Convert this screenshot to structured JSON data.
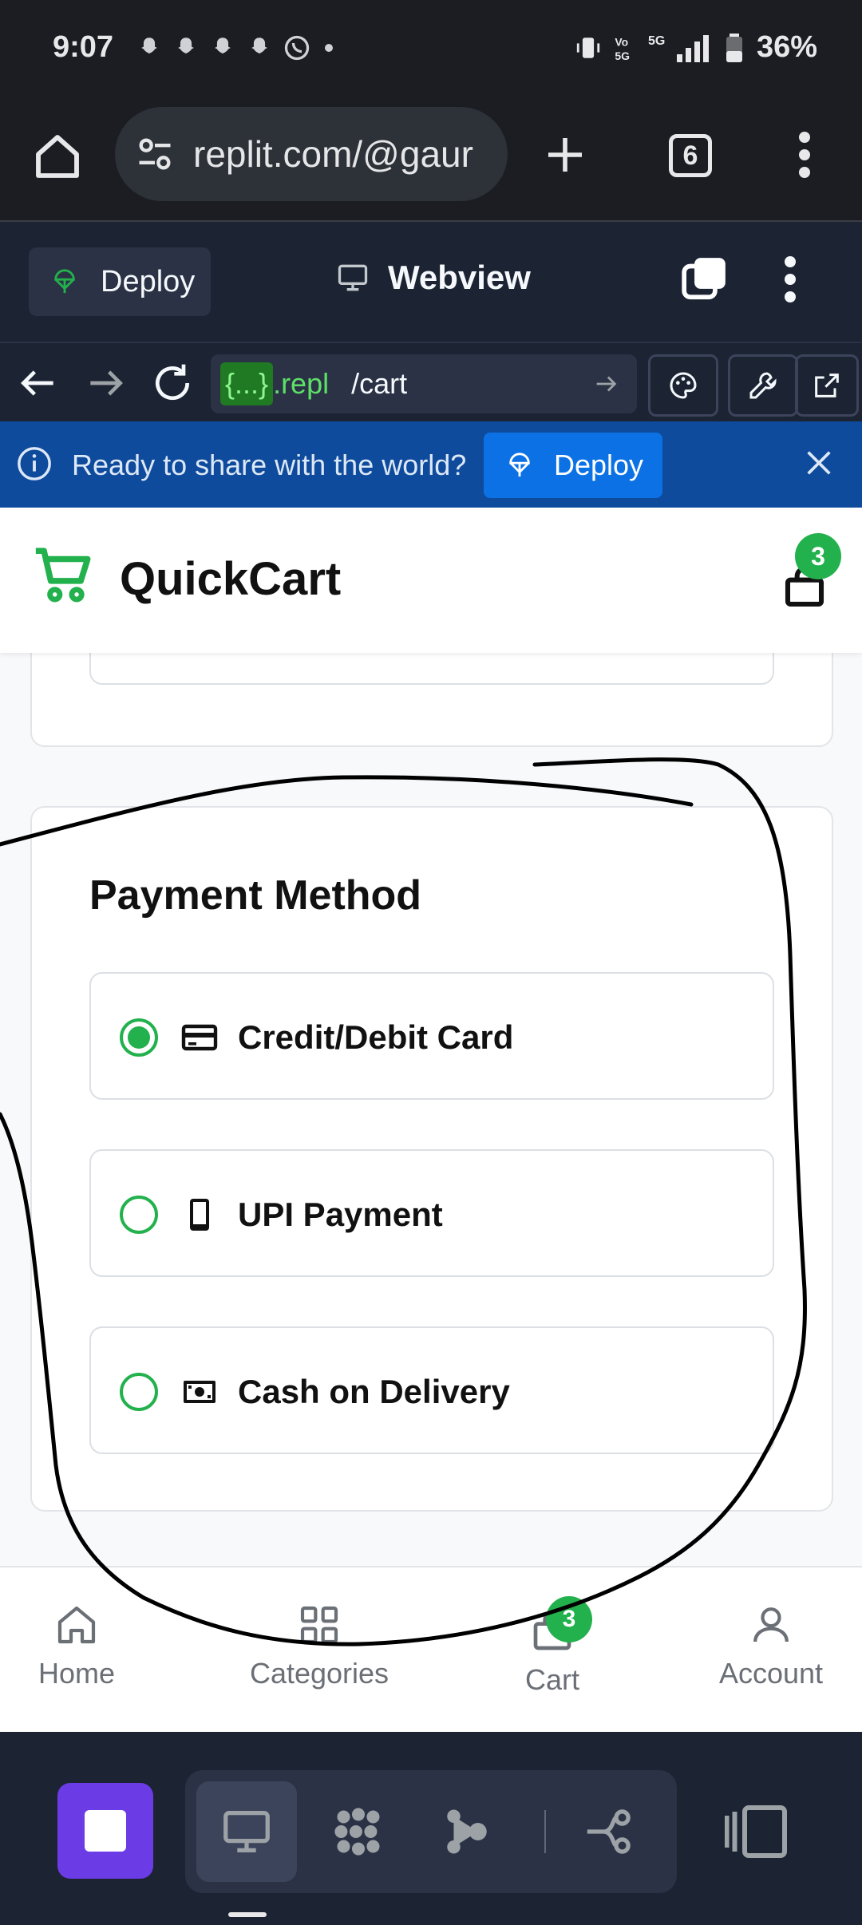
{
  "status_bar": {
    "time": "9:07",
    "left_icons": [
      "snapchat-icon",
      "snapchat-icon",
      "snapchat-icon",
      "snapchat-icon",
      "whatsapp-icon",
      "dot-icon"
    ],
    "right_icons": [
      "vibrate-icon",
      "volte-icon",
      "5g-icon",
      "signal-icon",
      "battery-icon"
    ],
    "battery": "36%"
  },
  "browser": {
    "url": "replit.com/@gaur",
    "tab_count": "6"
  },
  "replit_toolbar": {
    "deploy_label": "Deploy",
    "title": "Webview"
  },
  "webview_nav": {
    "repl_brace": "{...}",
    "repl_suffix": ".repl",
    "path": "/cart"
  },
  "banner": {
    "message": "Ready to share with the world?",
    "deploy_label": "Deploy"
  },
  "app": {
    "brand": "QuickCart",
    "cart_count": "3",
    "accent_color": "#22b14c"
  },
  "payment": {
    "title": "Payment Method",
    "options": [
      {
        "label": "Credit/Debit Card",
        "icon": "credit-card-icon",
        "selected": true
      },
      {
        "label": "UPI Payment",
        "icon": "smartphone-icon",
        "selected": false
      },
      {
        "label": "Cash on Delivery",
        "icon": "cash-icon",
        "selected": false
      }
    ]
  },
  "bottom_nav": {
    "items": [
      {
        "label": "Home",
        "icon": "home-icon"
      },
      {
        "label": "Categories",
        "icon": "grid-icon"
      },
      {
        "label": "Cart",
        "icon": "bag-icon"
      },
      {
        "label": "Account",
        "icon": "user-icon"
      }
    ],
    "cart_badge": "3"
  },
  "replit_bottom": {
    "buttons": [
      "stop-icon",
      "webview-icon",
      "agent-icon",
      "assistant-icon",
      "git-icon",
      "panel-icon"
    ]
  }
}
